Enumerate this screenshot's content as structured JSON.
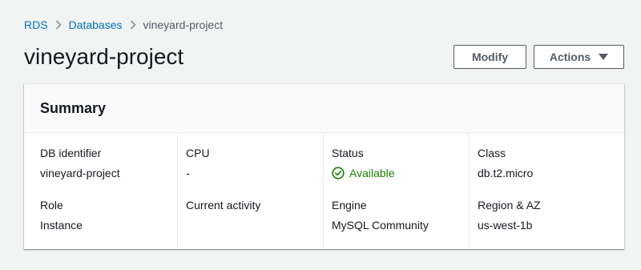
{
  "breadcrumb": {
    "items": [
      {
        "label": "RDS"
      },
      {
        "label": "Databases"
      },
      {
        "label": "vineyard-project"
      }
    ]
  },
  "header": {
    "title": "vineyard-project",
    "modify_label": "Modify",
    "actions_label": "Actions"
  },
  "summary": {
    "title": "Summary",
    "db_identifier": {
      "label": "DB identifier",
      "value": "vineyard-project"
    },
    "cpu": {
      "label": "CPU",
      "value": "-"
    },
    "status": {
      "label": "Status",
      "value": "Available",
      "color": "#1d8102",
      "icon": "check-circle-icon"
    },
    "class": {
      "label": "Class",
      "value": "db.t2.micro"
    },
    "role": {
      "label": "Role",
      "value": "Instance"
    },
    "current_activity": {
      "label": "Current activity",
      "value": ""
    },
    "engine": {
      "label": "Engine",
      "value": "MySQL Community"
    },
    "region_az": {
      "label": "Region & AZ",
      "value": "us-west-1b"
    }
  },
  "colors": {
    "link": "#0073bb",
    "background": "#f2f3f3",
    "success": "#1d8102"
  }
}
